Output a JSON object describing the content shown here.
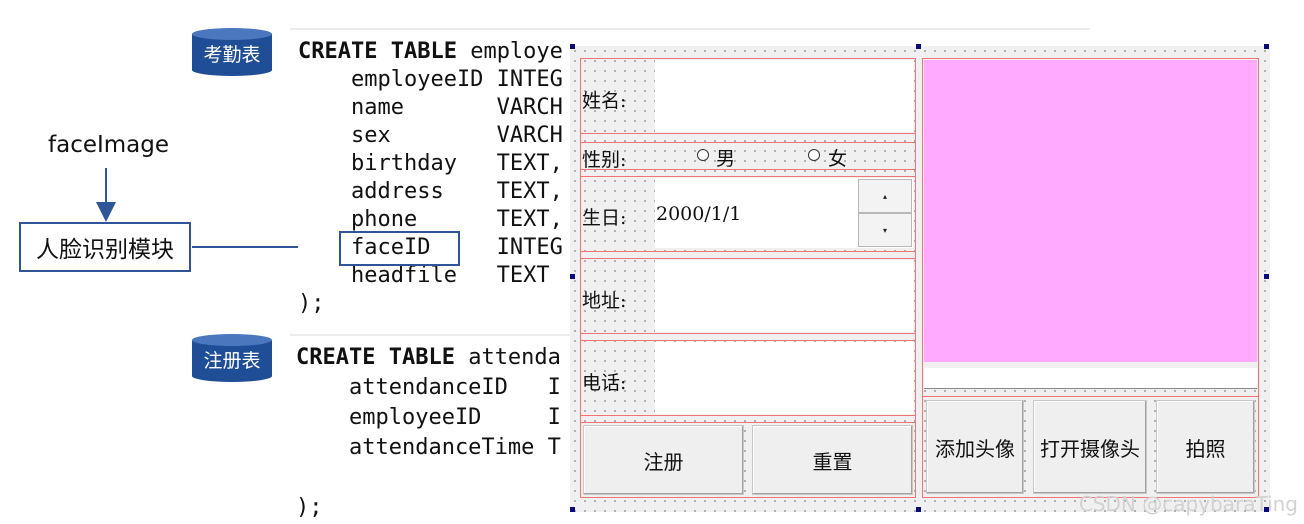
{
  "badges": {
    "attendance_table": "考勤表",
    "register_table": "注册表"
  },
  "diagram": {
    "face_image_label": "faceImage",
    "face_module_label": "人脸识别模块"
  },
  "code1": {
    "line1_kw": "CREATE TABLE",
    "line1_rest": " employe",
    "rows": [
      "    employeeID INTEG",
      "    name       VARCH",
      "    sex        VARCH",
      "    birthday   TEXT,",
      "    address    TEXT,",
      "    phone      TEXT,",
      "    faceID     INTEG",
      "    headfile   TEXT"
    ],
    "end": ");"
  },
  "code2": {
    "line1_kw": "CREATE TABLE",
    "line1_rest": " attenda",
    "rows": [
      "    attendanceID   I",
      "    employeeID     I",
      "    attendanceTime T"
    ],
    "end": ");"
  },
  "form": {
    "name_label": "姓名:",
    "gender_label": "性别:",
    "male": "男",
    "female": "女",
    "birth_label": "生日:",
    "birth_value": "2000/1/1",
    "spin_up": "▴",
    "spin_down": "▾",
    "address_label": "地址:",
    "phone_label": "电话:",
    "register_btn": "注册",
    "reset_btn": "重置",
    "add_avatar_btn": "添加头像",
    "open_camera_btn": "打开摄像头",
    "photo_btn": "拍照",
    "preview_color": "#ffaaff"
  },
  "watermark": "CSDN @capybaraTing"
}
